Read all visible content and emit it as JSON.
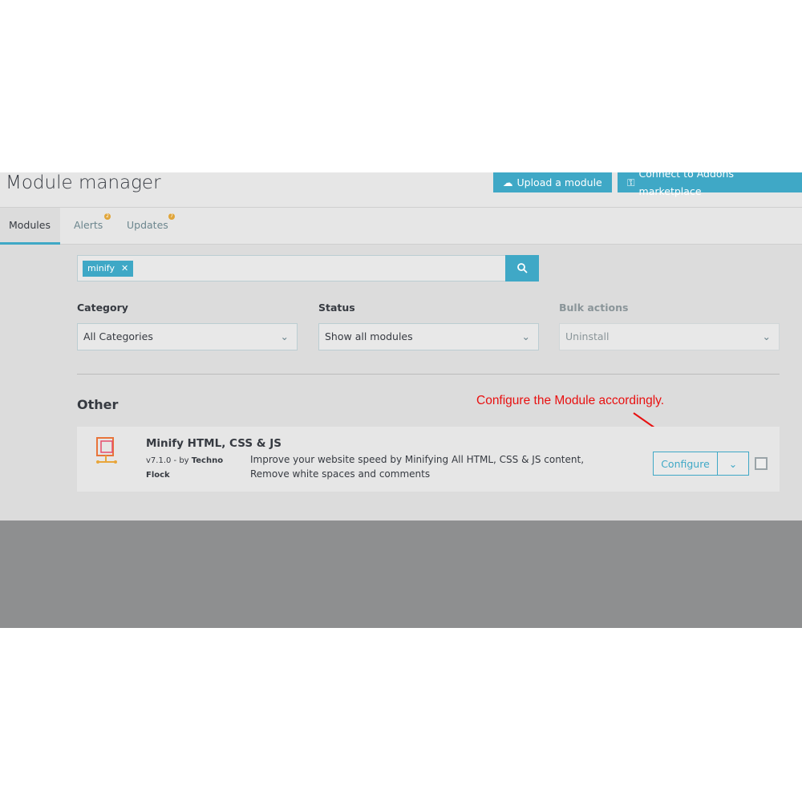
{
  "header": {
    "title": "Module manager",
    "upload_label": "Upload a module",
    "connect_label": "Connect to Addons marketplace"
  },
  "tabs": [
    {
      "label": "Modules",
      "active": true
    },
    {
      "label": "Alerts",
      "badge": "2"
    },
    {
      "label": "Updates",
      "badge": "7"
    }
  ],
  "search": {
    "chip": "minify"
  },
  "filters": {
    "category_label": "Category",
    "category_value": "All Categories",
    "status_label": "Status",
    "status_value": "Show all modules",
    "bulk_label": "Bulk actions",
    "bulk_value": "Uninstall"
  },
  "section": {
    "title": "Other"
  },
  "annotation": "Configure the Module accordingly.",
  "module": {
    "name": "Minify HTML, CSS & JS",
    "version": "v7.1.0 - by ",
    "author": "Techno Flock",
    "description": "Improve your website speed by Minifying All HTML, CSS & JS content, Remove white spaces and comments",
    "configure_label": "Configure"
  },
  "colors": {
    "accent": "#3fa8c6",
    "badge": "#e0a53a",
    "annotation": "#e81010"
  }
}
